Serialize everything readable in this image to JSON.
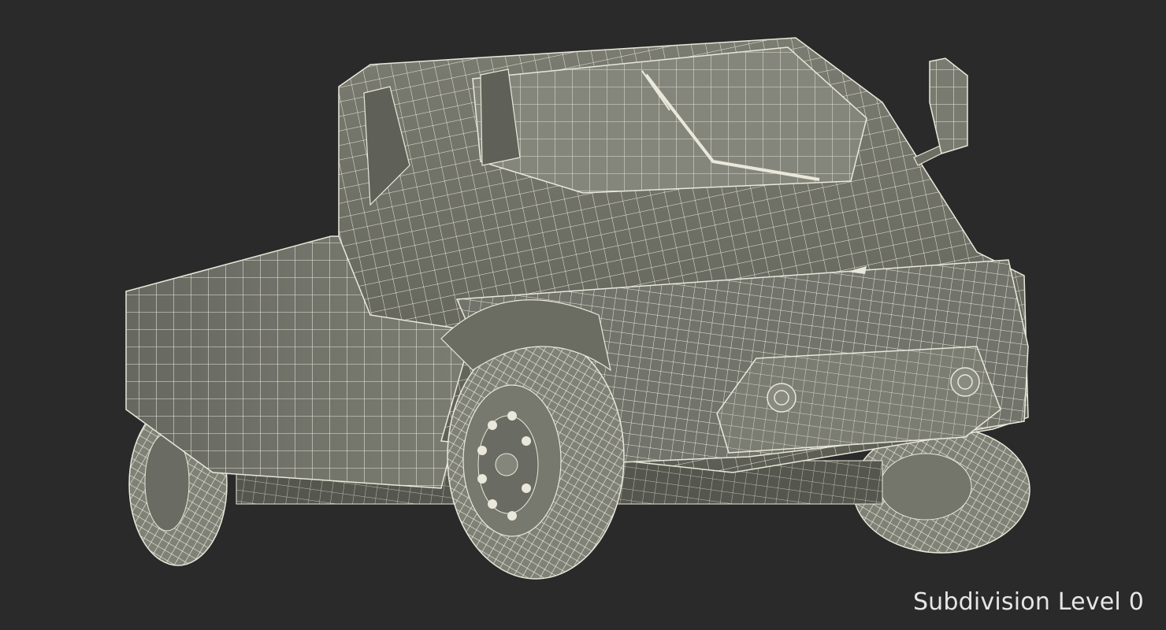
{
  "render": {
    "caption": "Subdivision Level 0",
    "colors": {
      "background": "#2a2a2a",
      "body_shade": "#6e6f64",
      "body_light": "#84857a",
      "body_dark": "#4a4b43",
      "wire": "#e9e8da",
      "tire": "#8c8c82",
      "caption": "#e6e6e6"
    }
  }
}
